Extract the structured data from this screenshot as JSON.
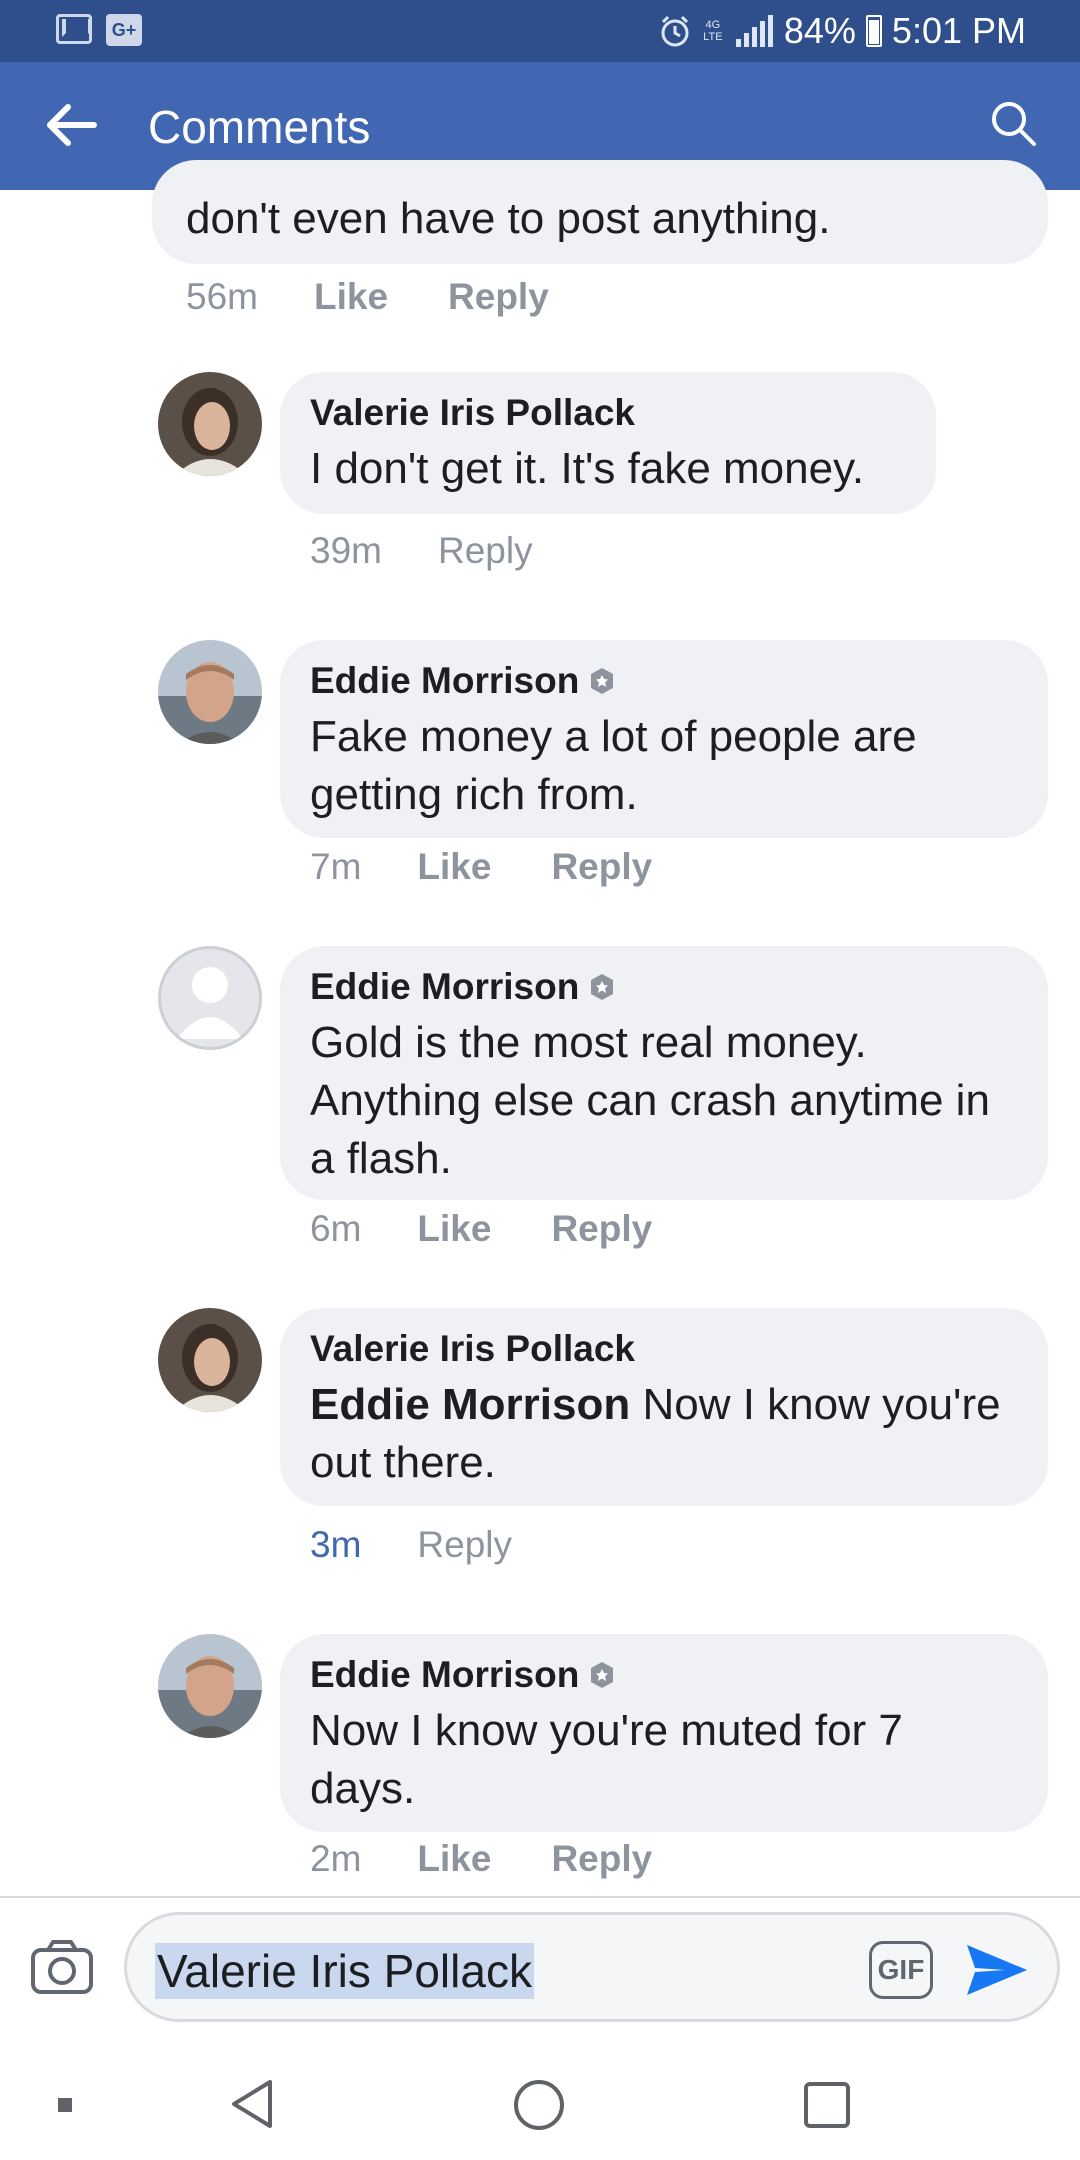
{
  "status_bar": {
    "battery": "84%",
    "time": "5:01 PM",
    "network": "4G LTE",
    "icons": [
      "gmail-icon",
      "google-plus-icon",
      "alarm-icon",
      "network-icon",
      "signal-icon",
      "battery-icon"
    ]
  },
  "app_bar": {
    "title": "Comments",
    "icons": [
      "back-arrow-icon",
      "search-icon"
    ]
  },
  "comments": [
    {
      "author": "",
      "text": "don't even have to post anything.",
      "time": "56m",
      "like": "Like",
      "reply": "Reply"
    },
    {
      "author": "Valerie Iris Pollack",
      "text": "I don't get it.  It's fake money.",
      "time": "39m",
      "reply": "Reply"
    },
    {
      "author": "Eddie Morrison",
      "verified": true,
      "text": "Fake money a lot of people are getting rich from.",
      "time": "7m",
      "like": "Like",
      "reply": "Reply"
    },
    {
      "author": "Eddie Morrison",
      "verified": true,
      "text": "Gold is the most real money.  Anything else can crash anytime in a flash.",
      "time": "6m",
      "like": "Like",
      "reply": "Reply"
    },
    {
      "author": "Valerie Iris Pollack",
      "mention": "Eddie Morrison",
      "text": " Now I know you're out there.",
      "time": "3m",
      "reply": "Reply"
    },
    {
      "author": "Eddie Morrison",
      "verified": true,
      "text": "Now I know you're muted for 7 days.",
      "time": "2m",
      "like": "Like",
      "reply": "Reply"
    }
  ],
  "composer": {
    "value": "Valerie Iris Pollack",
    "gif_label": "GIF",
    "icons": [
      "camera-icon",
      "send-icon"
    ]
  },
  "colors": {
    "status_bar": "#2f4f8c",
    "app_bar": "#4267b2",
    "bubble": "#f0f1f4",
    "meta_text": "#8d949e",
    "highlight_time": "#4267b2"
  }
}
